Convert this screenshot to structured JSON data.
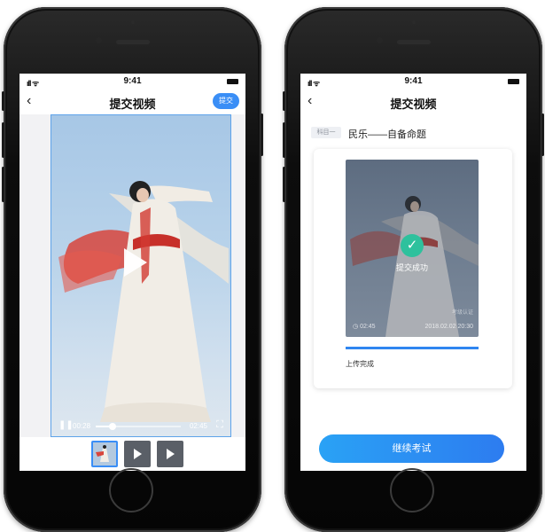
{
  "accent_color": "#3a8ef6",
  "left_screen": {
    "status": {
      "time": "9:41",
      "signal": "ıll ᯤ"
    },
    "nav": {
      "title": "提交视频",
      "submit_label": "提交",
      "back_icon": "chevron-left-icon"
    },
    "player": {
      "current_time": "00:28",
      "total_time": "02:45",
      "progress": 0.2,
      "play_icon": "play-icon",
      "pause_icon": "pause-icon",
      "fullscreen_icon": "fullscreen-icon"
    },
    "thumbnails": [
      {
        "active": true
      },
      {
        "active": false
      },
      {
        "active": false
      }
    ]
  },
  "right_screen": {
    "status": {
      "time": "9:41",
      "signal": "ıll ᯤ"
    },
    "nav": {
      "title": "提交视频",
      "back_icon": "chevron-left-icon"
    },
    "subject": {
      "tag": "科目一",
      "name": "民乐——自备命题"
    },
    "video_card": {
      "status_text": "提交成功",
      "duration": "02:45",
      "date": "2018.02.02 20:30",
      "watermark": "考级认证",
      "check_icon": "check-circle-icon"
    },
    "upload": {
      "progress": 1.0,
      "label": "上传完成",
      "color": "#2f86f0"
    },
    "continue_label": "继续考试"
  }
}
